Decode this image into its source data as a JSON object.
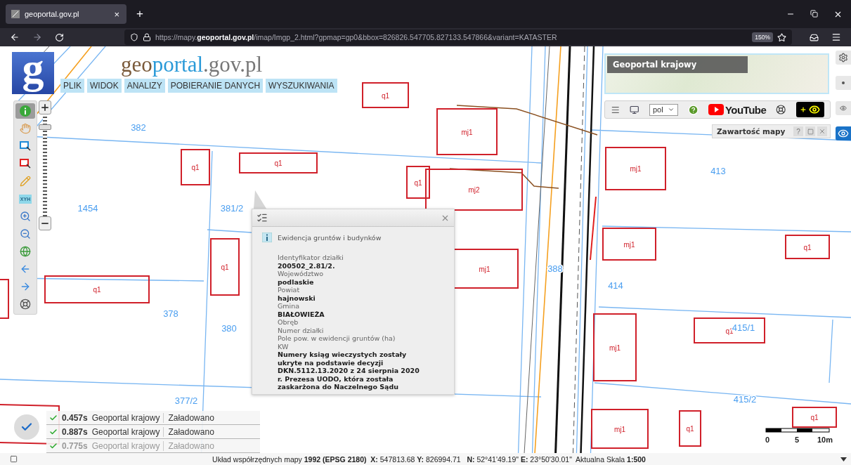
{
  "browser": {
    "tab_title": "geoportal.gov.pl",
    "tab_close": "×",
    "new_tab": "+",
    "url": "https://mapy.**geoportal.gov.pl**/imap/Imgp_2.html?gpmap=gp0&bbox=826826.547705.827133.547866&variant=KATASTER",
    "zoom": "150%"
  },
  "logo": {
    "mark": "g",
    "title_parts": [
      "geo",
      "portal",
      ".gov.pl"
    ]
  },
  "menu": [
    "PLIK",
    "WIDOK",
    "ANALIZY",
    "POBIERANIE DANYCH",
    "WYSZUKIWANIA"
  ],
  "tools": [
    {
      "kind": "info",
      "selected": true
    },
    {
      "kind": "pan",
      "selected": false
    },
    {
      "kind": "select-blue",
      "selected": false
    },
    {
      "kind": "select-red",
      "selected": false
    },
    {
      "kind": "pencil",
      "selected": false
    },
    {
      "kind": "xyh",
      "label": "XYH",
      "selected": false
    },
    {
      "kind": "zoom-in",
      "selected": false
    },
    {
      "kind": "zoom-out",
      "selected": false
    },
    {
      "kind": "globe",
      "selected": false
    },
    {
      "kind": "back",
      "selected": false
    },
    {
      "kind": "forward",
      "selected": false
    },
    {
      "kind": "compass",
      "selected": false
    }
  ],
  "zoom_slider": {
    "level": 0.9
  },
  "map": {
    "parcel_numbers": [
      "382",
      "1454",
      "381/2",
      "378",
      "380",
      "388",
      "413",
      "414",
      "415/1",
      "415/2",
      "377/2"
    ],
    "building_labels": [
      "q1",
      "mj1",
      "q1",
      "q1",
      "q1",
      "mj2",
      "mj1",
      "q1",
      "q1",
      "mj1",
      "mj1",
      "q1",
      "q1",
      "mj1",
      "mj1",
      "q1",
      "q1"
    ],
    "scale_labels": [
      "0",
      "5",
      "10m"
    ]
  },
  "popup": {
    "source": "Ewidencja gruntów i budynków",
    "fields": [
      {
        "label": "Identyfikator działki",
        "value": "200502_2.81/2."
      },
      {
        "label": "Województwo",
        "value": "podlaskie"
      },
      {
        "label": "Powiat",
        "value": "hajnowski"
      },
      {
        "label": "Gmina",
        "value": "BIAŁOWIEŻA"
      },
      {
        "label": "Obręb"
      },
      {
        "label": "Numer działki"
      },
      {
        "label": "Pole pow. w ewidencji gruntów (ha)"
      },
      {
        "label": "KW",
        "value": "Numery ksiąg wieczystych zostały ukryte na podstawie decyzji DKN.5112.13.2020 z 24 sierpnia 2020 r. Prezesa UODO, która została zaskarżona do Naczelnego Sądu"
      }
    ]
  },
  "right_panel": {
    "basemap_title": "Geoportal krajowy",
    "language": "pol",
    "video_brand": "YouTube",
    "contents_title": "Zawartość mapy",
    "contents_help": "?"
  },
  "side_buttons": [
    {
      "kind": "settings",
      "selected": false
    },
    {
      "kind": "dot",
      "selected": false
    },
    {
      "kind": "eye-small",
      "selected": false
    },
    {
      "kind": "eye",
      "selected": true
    }
  ],
  "load_status": [
    {
      "time": "0.457s",
      "source": "Geoportal krajowy",
      "status": "Załadowano",
      "dimmed": false
    },
    {
      "time": "0.887s",
      "source": "Geoportal krajowy",
      "status": "Załadowano",
      "dimmed": false
    },
    {
      "time": "0.775s",
      "source": "Geoportal krajowy",
      "status": "Załadowano",
      "dimmed": true
    }
  ],
  "status_bar": "Układ współrzędnych mapy **1992 (EPSG 2180)**  **X:** 547813.68 **Y:** 826994.71   **N:** 52°41'49.19\" **E:** 23°50'30.01\"  Aktualna Skala **1:500**"
}
